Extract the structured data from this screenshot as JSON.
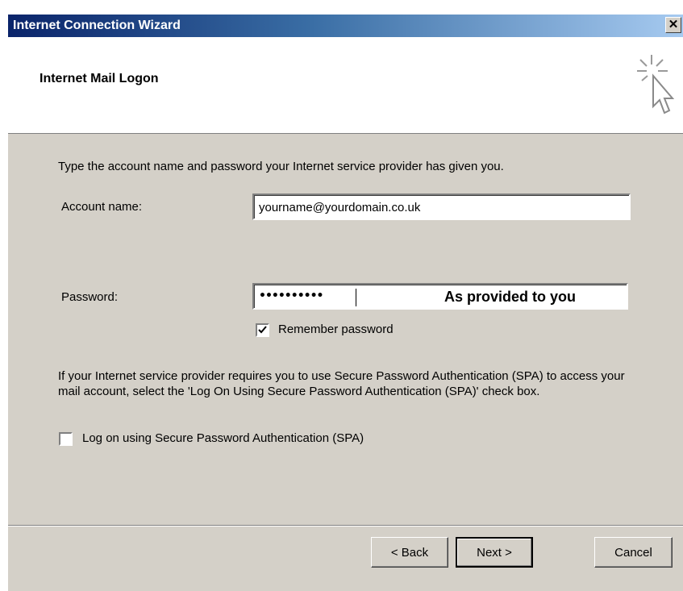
{
  "window": {
    "title": "Internet Connection Wizard",
    "close_glyph": "✕"
  },
  "header": {
    "title": "Internet Mail Logon"
  },
  "form": {
    "intro": "Type the account name and password your Internet service provider has given you.",
    "account_label": "Account name:",
    "account_value": "yourname@yourdomain.co.uk",
    "password_label": "Password:",
    "password_mask": "••••••••••",
    "password_note": "As provided to you",
    "remember_label": "Remember password",
    "remember_checked": true,
    "spa_text": "If your Internet service provider requires you to use Secure Password Authentication (SPA) to access your mail account, select the 'Log On Using Secure Password Authentication (SPA)' check box.",
    "spa_label": "Log on using Secure Password Authentication (SPA)",
    "spa_checked": false
  },
  "buttons": {
    "back": "< Back",
    "next": "Next >",
    "cancel": "Cancel"
  }
}
